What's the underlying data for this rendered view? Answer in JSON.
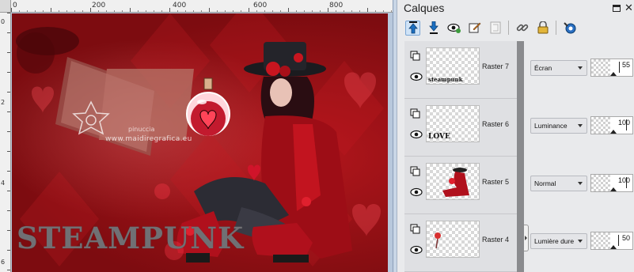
{
  "canvas": {
    "ruler_top_labels": [
      "0",
      "200",
      "400",
      "600",
      "800"
    ],
    "ruler_left_labels": [
      "0",
      "2",
      "4",
      "6"
    ],
    "watermark_name": "pinuccia",
    "watermark_url": "www.maidiregrafica.eu",
    "title_text": "STEAMPUNK"
  },
  "panel": {
    "title": "Calques",
    "toolbar_icons": [
      "move-up-icon",
      "move-down-icon",
      "visibility-icon",
      "edit-icon",
      "group-icon",
      "link-icon",
      "lock-icon",
      "properties-icon"
    ],
    "layers": [
      {
        "name": "Raster 7",
        "blend": "Écran",
        "opacity": "55",
        "opacity_fraction": 0.55,
        "thumb_text": "steampunk"
      },
      {
        "name": "Raster 6",
        "blend": "Luminance",
        "opacity": "100",
        "opacity_fraction": 1.0,
        "thumb_text": "LOVE"
      },
      {
        "name": "Raster 5",
        "blend": "Normal",
        "opacity": "100",
        "opacity_fraction": 1.0,
        "thumb_text": ""
      },
      {
        "name": "Raster 4",
        "blend": "Lumière dure",
        "opacity": "50",
        "opacity_fraction": 0.5,
        "thumb_text": ""
      }
    ]
  },
  "colors": {
    "canvas_red": "#b3161c",
    "dark_red": "#6d0a0e",
    "panel_bg": "#e9eaec",
    "accent_blue": "#3a6fb5"
  }
}
